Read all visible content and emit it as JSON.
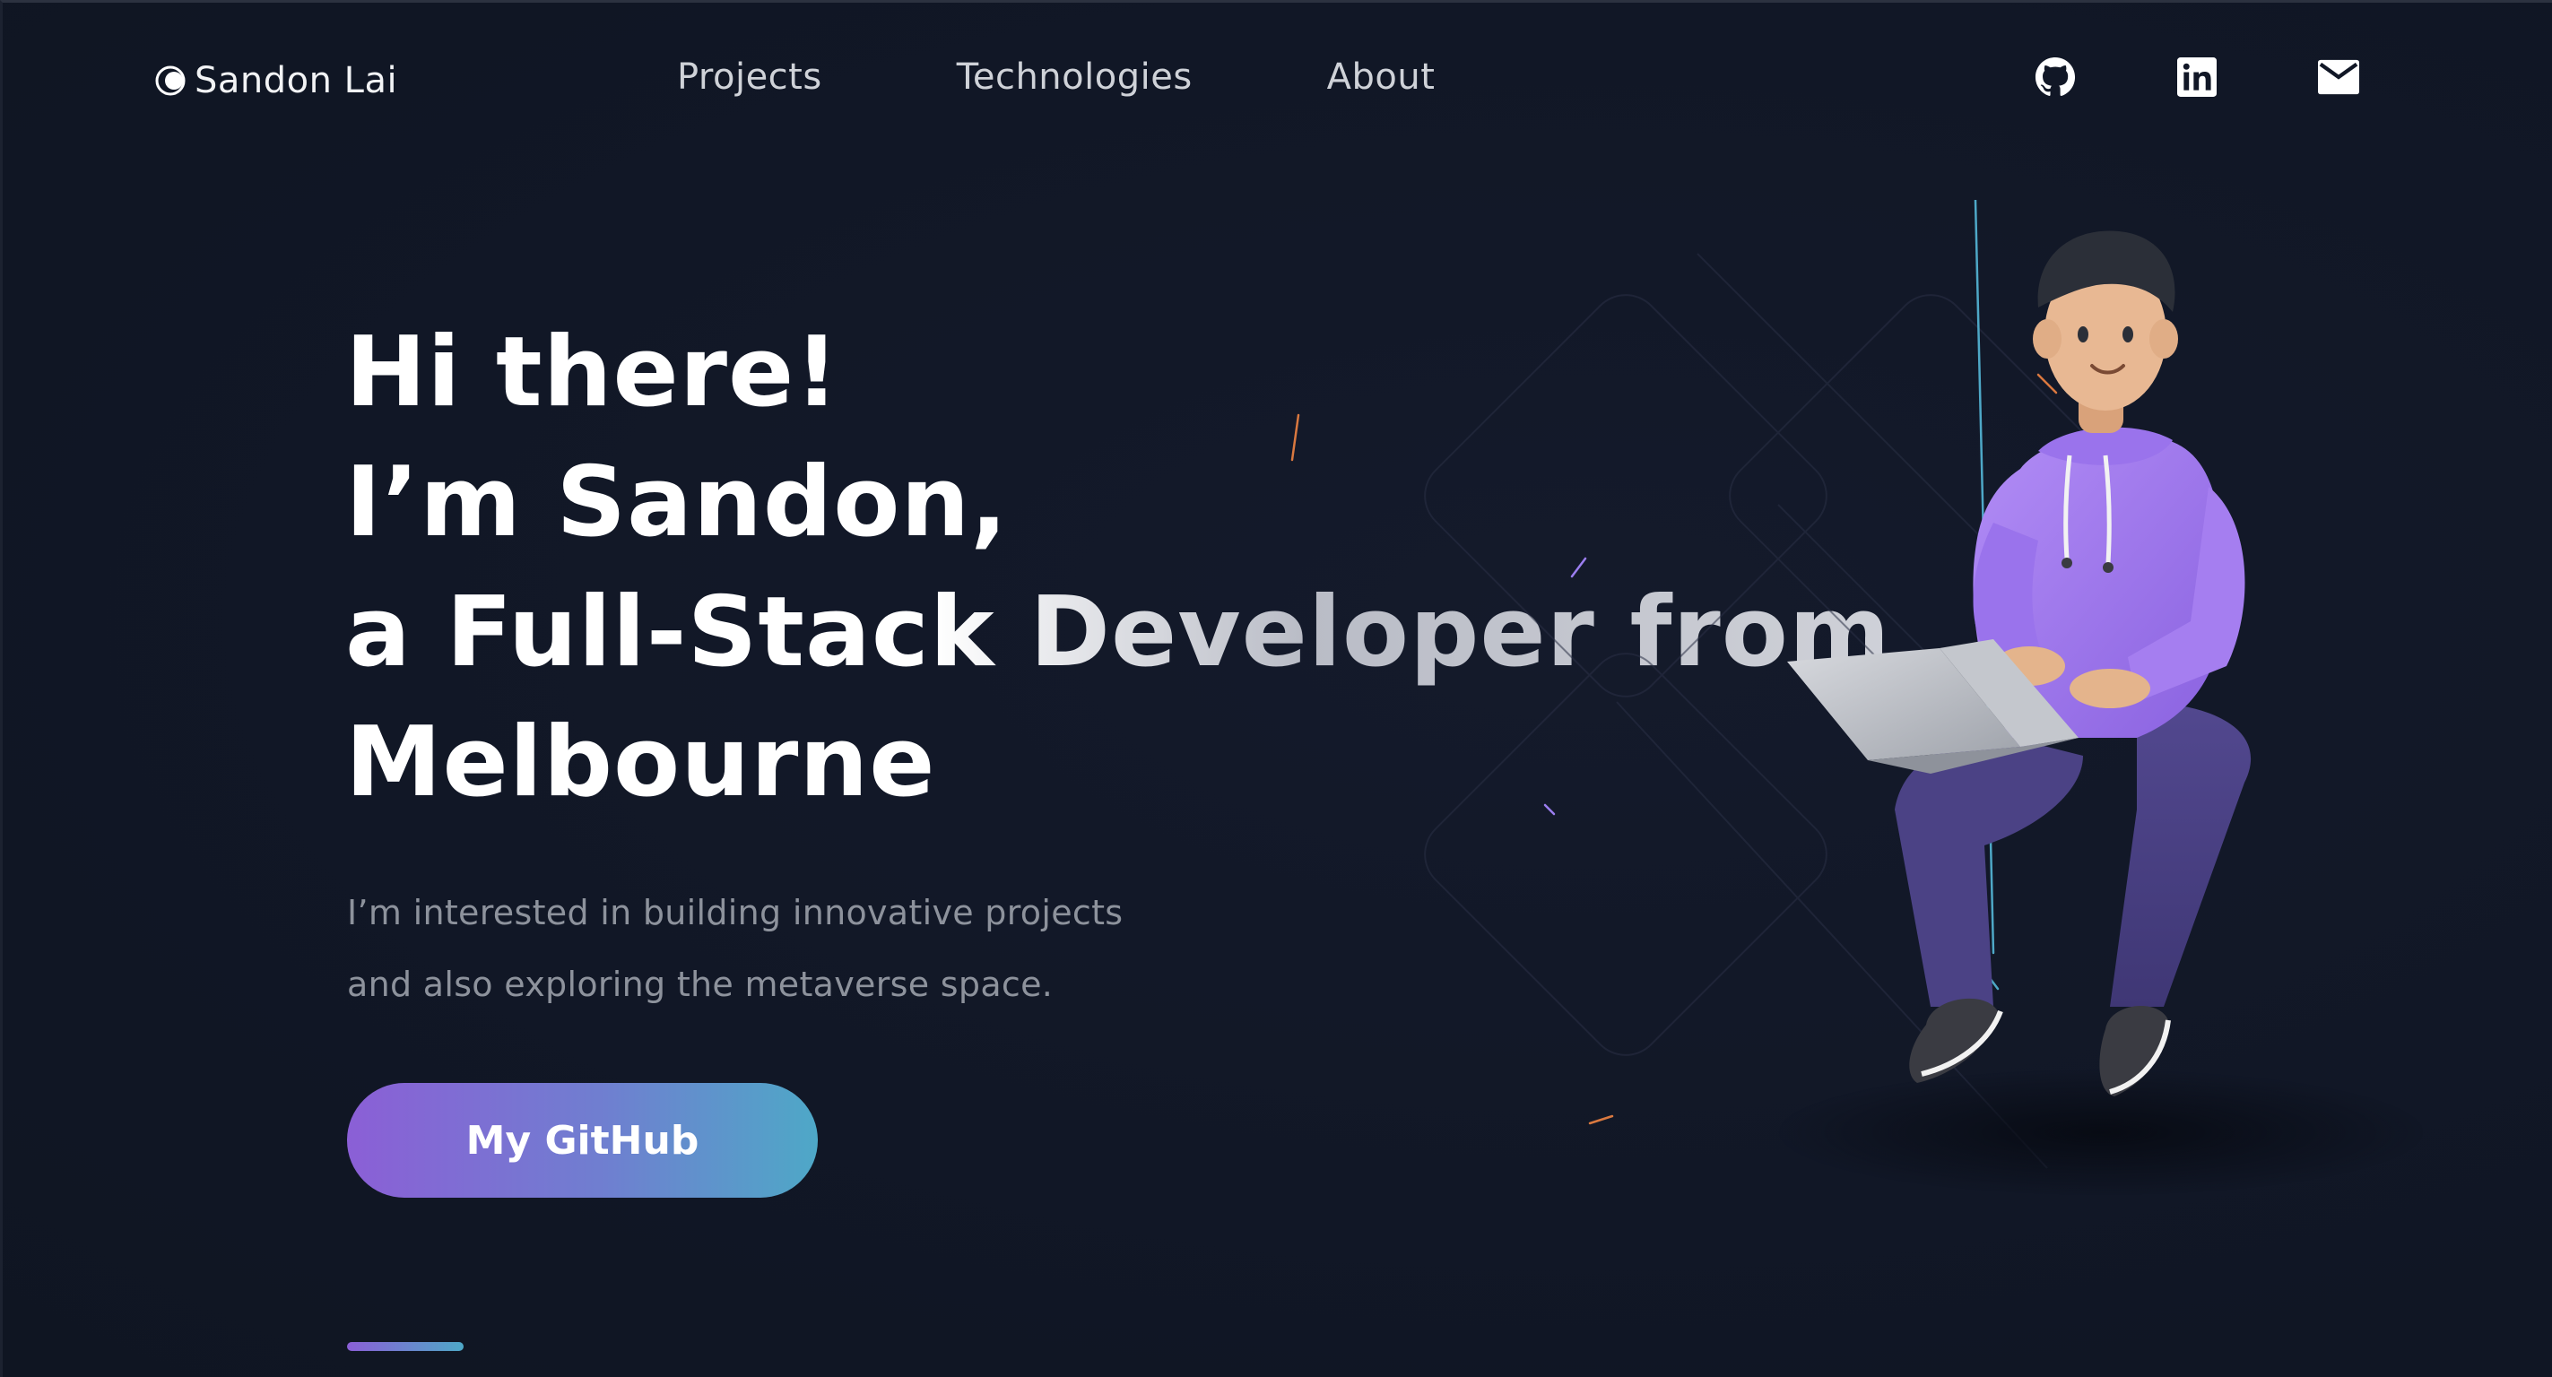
{
  "brand": {
    "name": "Sandon Lai",
    "logo_icon": "crescent-logo-icon"
  },
  "nav": {
    "items": [
      {
        "label": "Projects"
      },
      {
        "label": "Technologies"
      },
      {
        "label": "About"
      }
    ]
  },
  "socials": [
    {
      "icon": "github-icon"
    },
    {
      "icon": "linkedin-icon"
    },
    {
      "icon": "mail-icon"
    }
  ],
  "hero": {
    "lines": [
      "Hi there!",
      "I’m Sandon,",
      "a Full-Stack Developer from",
      "Melbourne"
    ],
    "subtitle_lines": [
      "I’m interested in building innovative projects",
      "and also exploring the metaverse space."
    ],
    "cta_label": "My GitHub"
  },
  "colors": {
    "background": "#111726",
    "accent_purple": "#8b5fd6",
    "accent_teal": "#4ea8c7",
    "hoodie": "#a57ef0",
    "pants": "#4b4285"
  }
}
